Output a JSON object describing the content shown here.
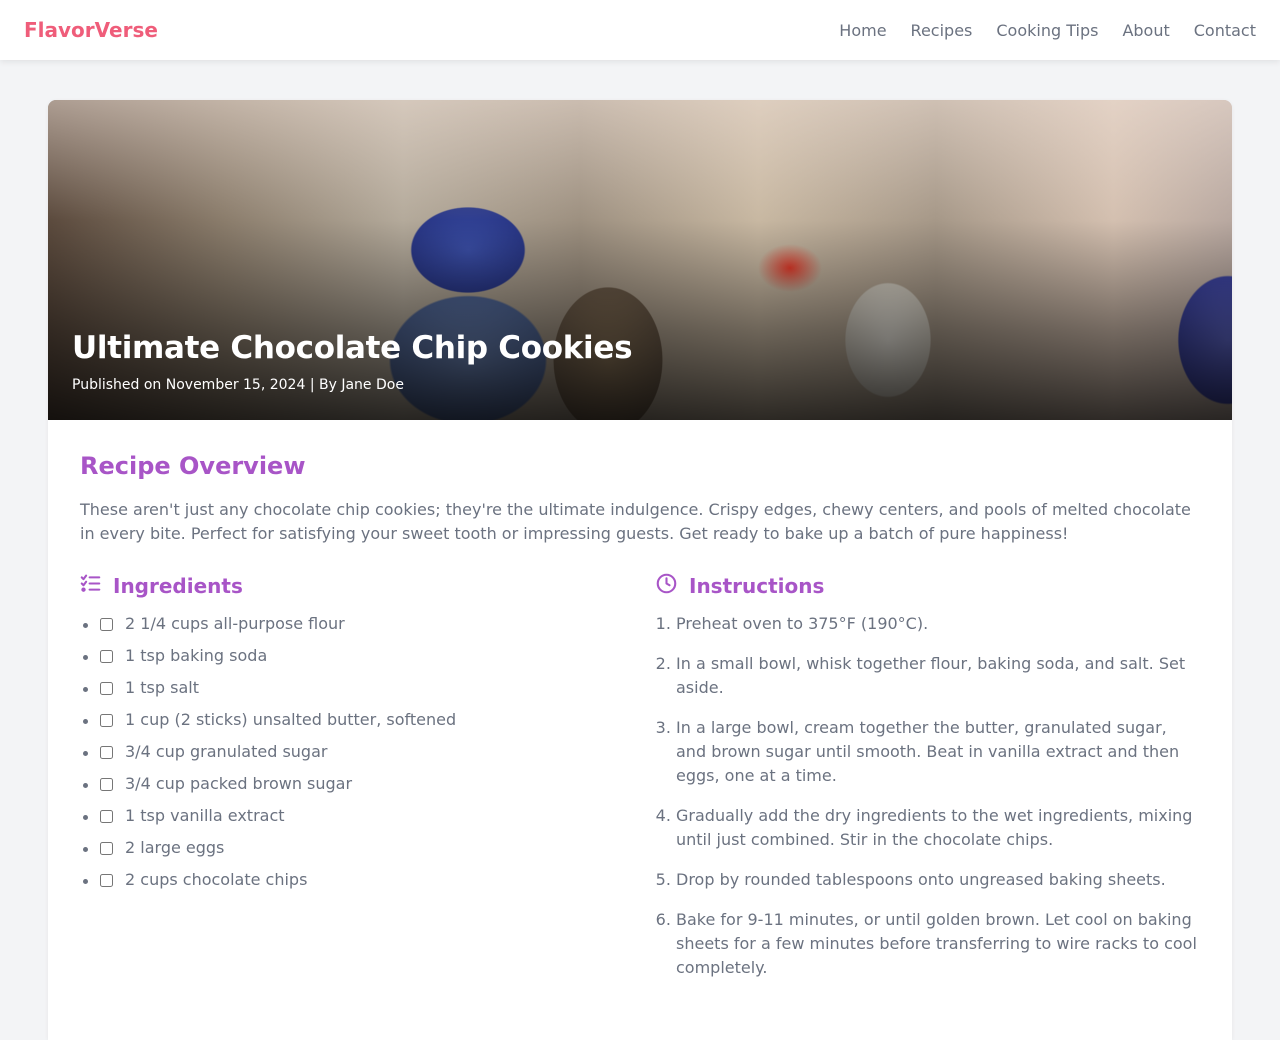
{
  "header": {
    "brand": "FlavorVerse",
    "nav": [
      "Home",
      "Recipes",
      "Cooking Tips",
      "About",
      "Contact"
    ]
  },
  "colors": {
    "brand": "#ef5d7a",
    "accent": "#a855c7",
    "text": "#6b7280",
    "background": "#f3f4f6"
  },
  "hero": {
    "title": "Ultimate Chocolate Chip Cookies",
    "meta": "Published on November 15, 2024 | By Jane Doe"
  },
  "overview": {
    "heading": "Recipe Overview",
    "text": "These aren't just any chocolate chip cookies; they're the ultimate indulgence. Crispy edges, chewy centers, and pools of melted chocolate in every bite. Perfect for satisfying your sweet tooth or impressing guests. Get ready to bake up a batch of pure happiness!"
  },
  "ingredients": {
    "heading": "Ingredients",
    "icon": "list-check-icon",
    "items": [
      "2 1/4 cups all-purpose flour",
      "1 tsp baking soda",
      "1 tsp salt",
      "1 cup (2 sticks) unsalted butter, softened",
      "3/4 cup granulated sugar",
      "3/4 cup packed brown sugar",
      "1 tsp vanilla extract",
      "2 large eggs",
      "2 cups chocolate chips"
    ]
  },
  "instructions": {
    "heading": "Instructions",
    "icon": "clock-icon",
    "steps": [
      "Preheat oven to 375°F (190°C).",
      "In a small bowl, whisk together flour, baking soda, and salt. Set aside.",
      "In a large bowl, cream together the butter, granulated sugar, and brown sugar until smooth. Beat in vanilla extract and then eggs, one at a time.",
      "Gradually add the dry ingredients to the wet ingredients, mixing until just combined. Stir in the chocolate chips.",
      "Drop by rounded tablespoons onto ungreased baking sheets.",
      "Bake for 9-11 minutes, or until golden brown. Let cool on baking sheets for a few minutes before transferring to wire racks to cool completely."
    ]
  }
}
